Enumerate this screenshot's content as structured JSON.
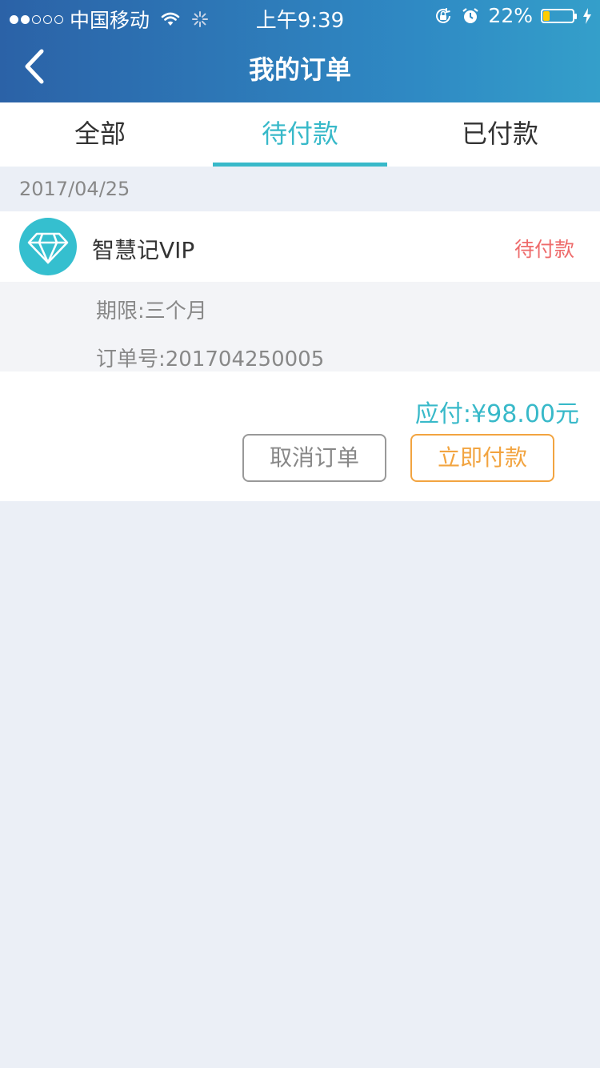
{
  "status_bar": {
    "carrier": "中国移动",
    "time": "上午9:39",
    "battery": "22%",
    "battery_level": 0.22,
    "signal_bars": 2
  },
  "nav": {
    "title": "我的订单"
  },
  "tabs": [
    {
      "label": "全部",
      "active": false
    },
    {
      "label": "待付款",
      "active": true
    },
    {
      "label": "已付款",
      "active": false
    }
  ],
  "orders": [
    {
      "date": "2017/04/25",
      "product": "智慧记VIP",
      "status": "待付款",
      "period": "期限:三个月",
      "order_no": "订单号:201704250005",
      "amount": "应付:¥98.00元",
      "cancel_label": "取消订单",
      "pay_label": "立即付款",
      "icon": "diamond-icon"
    }
  ],
  "colors": {
    "accent": "#38b9c9",
    "status_pending": "#ee6b6b",
    "pay_button": "#f2a440",
    "header_start": "#2b62a7",
    "header_end": "#349fca"
  }
}
